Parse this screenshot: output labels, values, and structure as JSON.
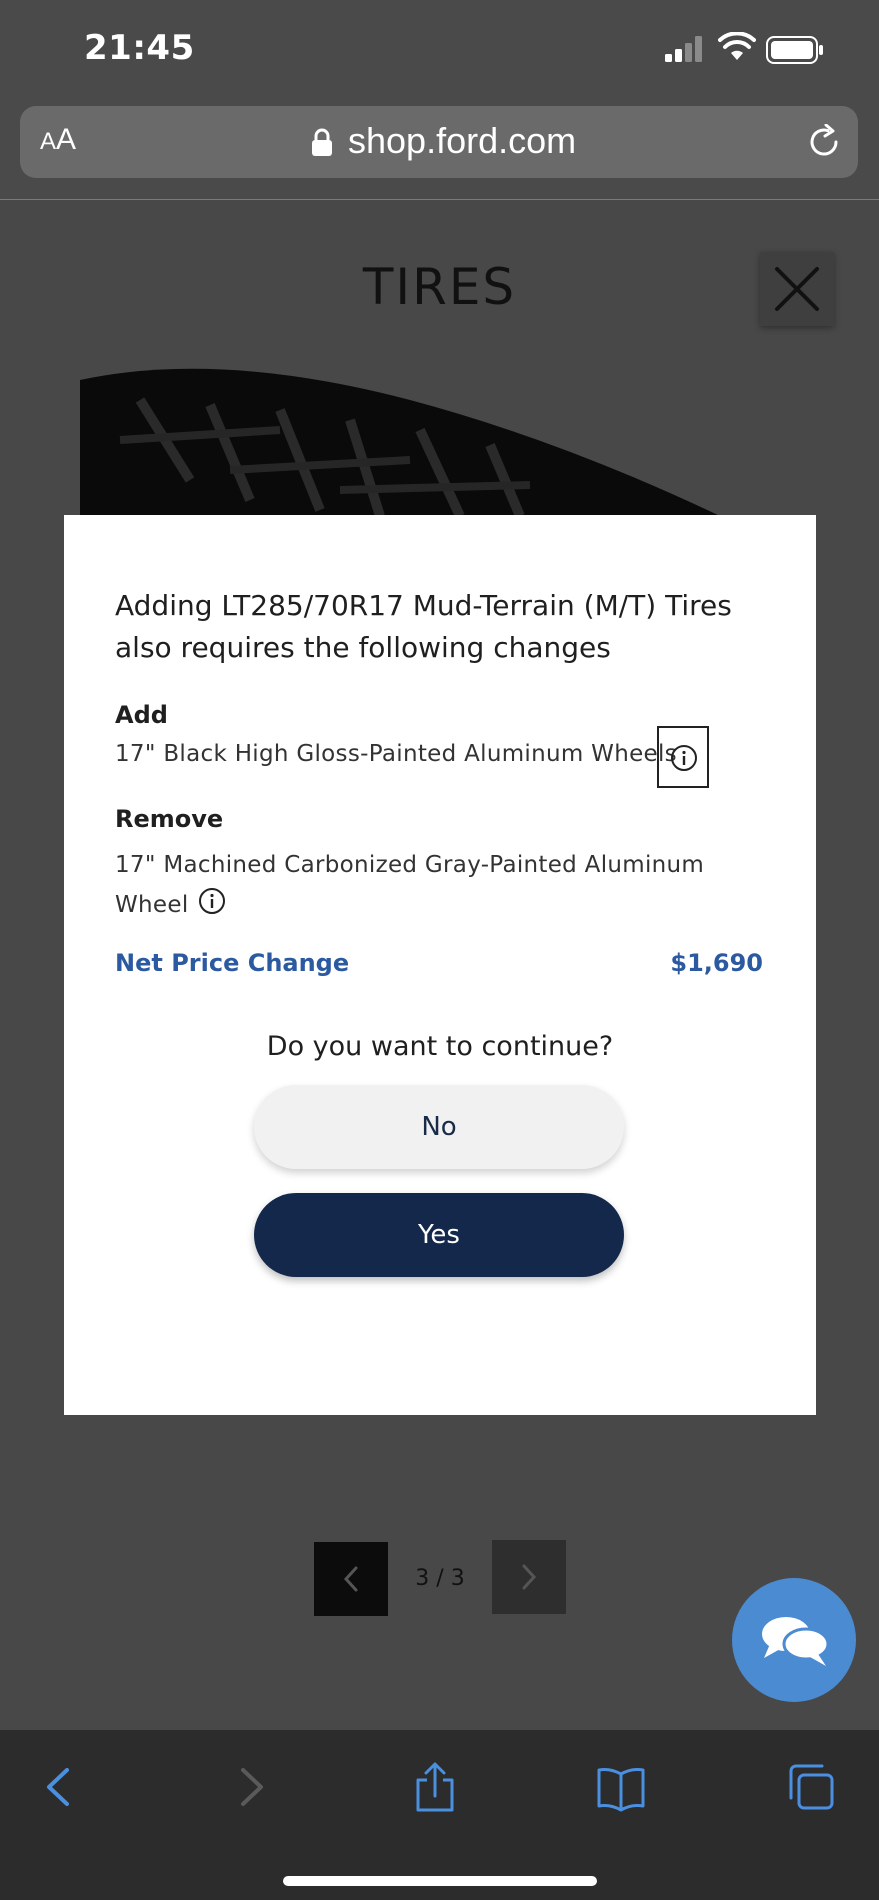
{
  "status_bar": {
    "time": "21:45"
  },
  "browser": {
    "aa_label_small": "A",
    "aa_label": "A",
    "url": "shop.ford.com"
  },
  "page": {
    "title": "TIRES",
    "pager_text": "3 / 3"
  },
  "modal": {
    "heading": "Adding LT285/70R17 Mud-Terrain (M/T) Tires also requires the following changes",
    "add_label": "Add",
    "add_item": "17\" Black High Gloss-Painted Aluminum Wheels",
    "remove_label": "Remove",
    "remove_item": "17\" Machined Carbonized Gray-Painted Aluminum Wheel",
    "net_price_label": "Net Price Change",
    "net_price_value": "$1,690",
    "question": "Do you want to continue?",
    "no_label": "No",
    "yes_label": "Yes"
  },
  "colors": {
    "accent_blue": "#2c5aa0",
    "yes_button": "#14284b",
    "chat_button": "#4b8bd1"
  },
  "icons": [
    "signal-icon",
    "wifi-icon",
    "battery-icon",
    "lock-icon",
    "reload-icon",
    "close-icon",
    "info-icon",
    "chevron-left-icon",
    "chevron-right-icon",
    "chat-icon",
    "back-icon",
    "forward-icon",
    "share-icon",
    "bookmarks-icon",
    "tabs-icon"
  ]
}
